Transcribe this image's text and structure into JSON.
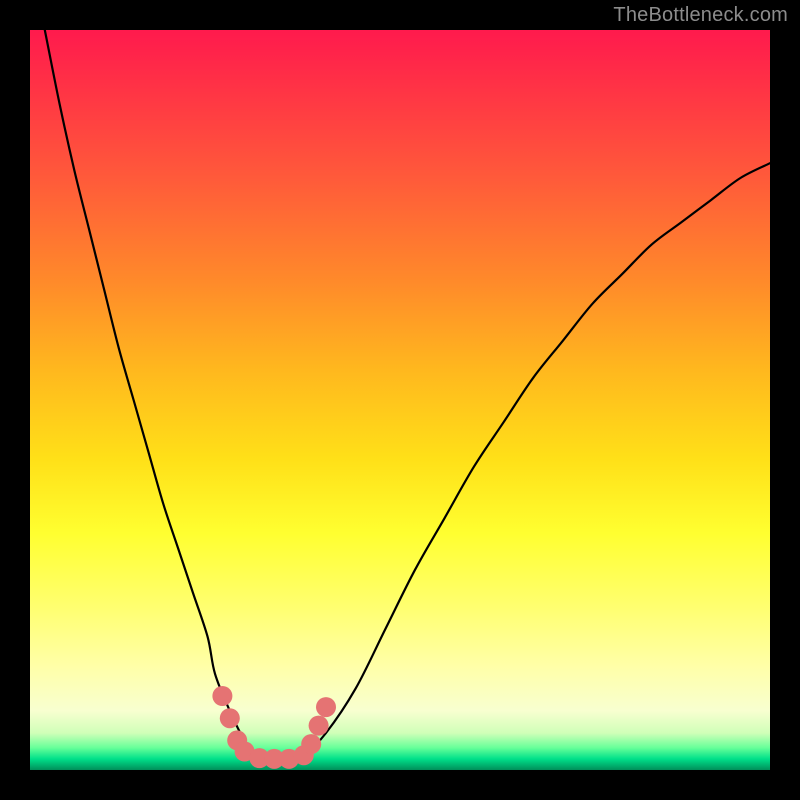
{
  "watermark": "TheBottleneck.com",
  "colors": {
    "background": "#000000",
    "curve_stroke": "#000000",
    "marker_fill": "#e57373",
    "gradient_top": "#ff1a4d",
    "gradient_bottom": "#008f5a"
  },
  "chart_data": {
    "type": "line",
    "title": "",
    "xlabel": "",
    "ylabel": "",
    "xlim": [
      0,
      100
    ],
    "ylim": [
      0,
      100
    ],
    "grid": false,
    "series": [
      {
        "name": "bottleneck-curve",
        "x": [
          0,
          2,
          4,
          6,
          8,
          10,
          12,
          14,
          16,
          18,
          20,
          22,
          24,
          25,
          27,
          29,
          31,
          33,
          35,
          37,
          40,
          44,
          48,
          52,
          56,
          60,
          64,
          68,
          72,
          76,
          80,
          84,
          88,
          92,
          96,
          100
        ],
        "values": [
          110,
          100,
          90,
          81,
          73,
          65,
          57,
          50,
          43,
          36,
          30,
          24,
          18,
          13,
          8,
          4,
          2,
          1.5,
          1.5,
          2,
          5,
          11,
          19,
          27,
          34,
          41,
          47,
          53,
          58,
          63,
          67,
          71,
          74,
          77,
          80,
          82
        ]
      }
    ],
    "markers": [
      {
        "x": 26,
        "y": 10
      },
      {
        "x": 27,
        "y": 7
      },
      {
        "x": 28,
        "y": 4
      },
      {
        "x": 29,
        "y": 2.5
      },
      {
        "x": 31,
        "y": 1.6
      },
      {
        "x": 33,
        "y": 1.5
      },
      {
        "x": 35,
        "y": 1.5
      },
      {
        "x": 37,
        "y": 2
      },
      {
        "x": 38,
        "y": 3.5
      },
      {
        "x": 39,
        "y": 6
      },
      {
        "x": 40,
        "y": 8.5
      }
    ]
  }
}
